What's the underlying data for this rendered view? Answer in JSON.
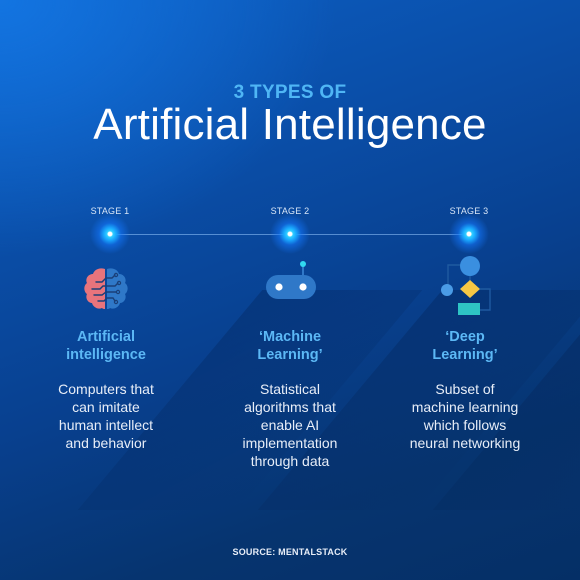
{
  "header": {
    "subtitle": "3 TYPES OF",
    "title": "Artificial Intelligence"
  },
  "stages": [
    {
      "stage_label": "STAGE 1",
      "icon": "brain-icon",
      "title_line1": "Artificial",
      "title_line2": "intelligence",
      "desc_lines": [
        "Computers that",
        "can imitate",
        "human intellect",
        "and behavior"
      ]
    },
    {
      "stage_label": "STAGE 2",
      "icon": "robot-icon",
      "title_line1": "‘Machine",
      "title_line2": "Learning’",
      "desc_lines": [
        "Statistical",
        "algorithms that",
        "enable AI",
        "implementation",
        "through data"
      ]
    },
    {
      "stage_label": "STAGE 3",
      "icon": "flowchart-icon",
      "title_line1": "‘Deep",
      "title_line2": "Learning’",
      "desc_lines": [
        "Subset of",
        "machine learning",
        "which follows",
        "neural networking"
      ]
    }
  ],
  "footer": {
    "source": "SOURCE: MENTALSTACK"
  },
  "colors": {
    "accent_blue": "#5cb8f5",
    "brain_left": "#e8747c",
    "brain_right": "#2f78c8",
    "diamond_yellow": "#f7c744",
    "rect_teal": "#2ec4c4",
    "node_cyan": "#31d0ff"
  }
}
